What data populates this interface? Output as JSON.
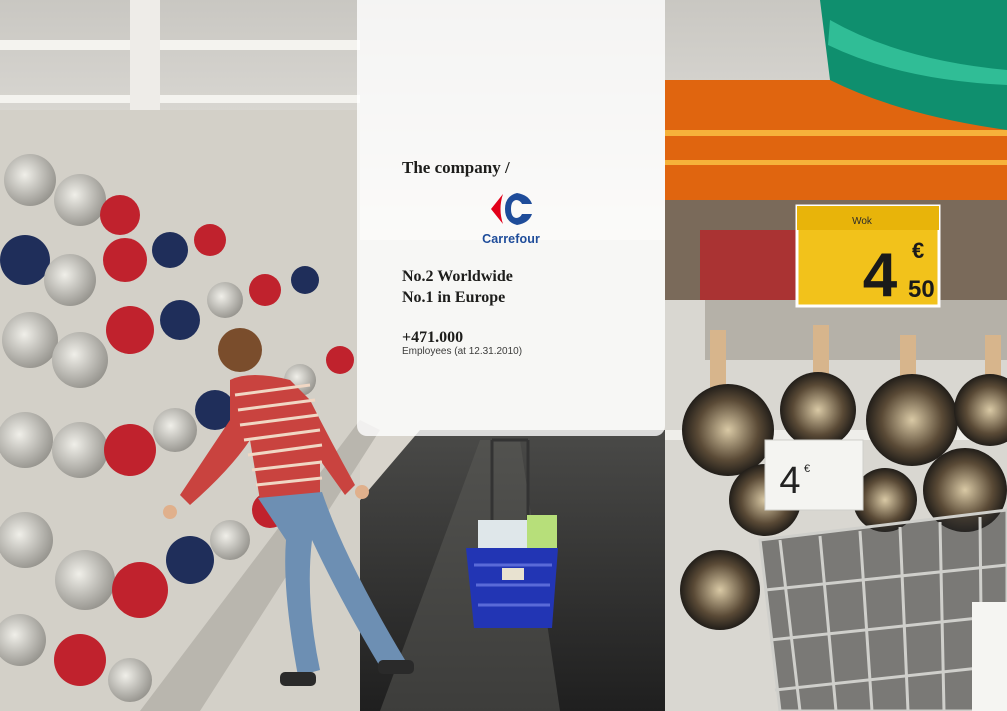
{
  "page": {
    "heading": "The company /",
    "logo": {
      "name": "Carrefour",
      "colors": {
        "red": "#e2001a",
        "blue": "#1e4c9a"
      }
    },
    "rankings": [
      "No.2 Worldwide",
      "No.1 in Europe"
    ],
    "employees": {
      "value": "+471.000",
      "label": "Employees (at 12.31.2010)"
    }
  },
  "photo": {
    "price_signs": [
      {
        "product": "Wok",
        "price_int": "4",
        "price_cents": "50",
        "currency": "€"
      },
      {
        "price_int": "4",
        "currency": "€"
      }
    ]
  }
}
